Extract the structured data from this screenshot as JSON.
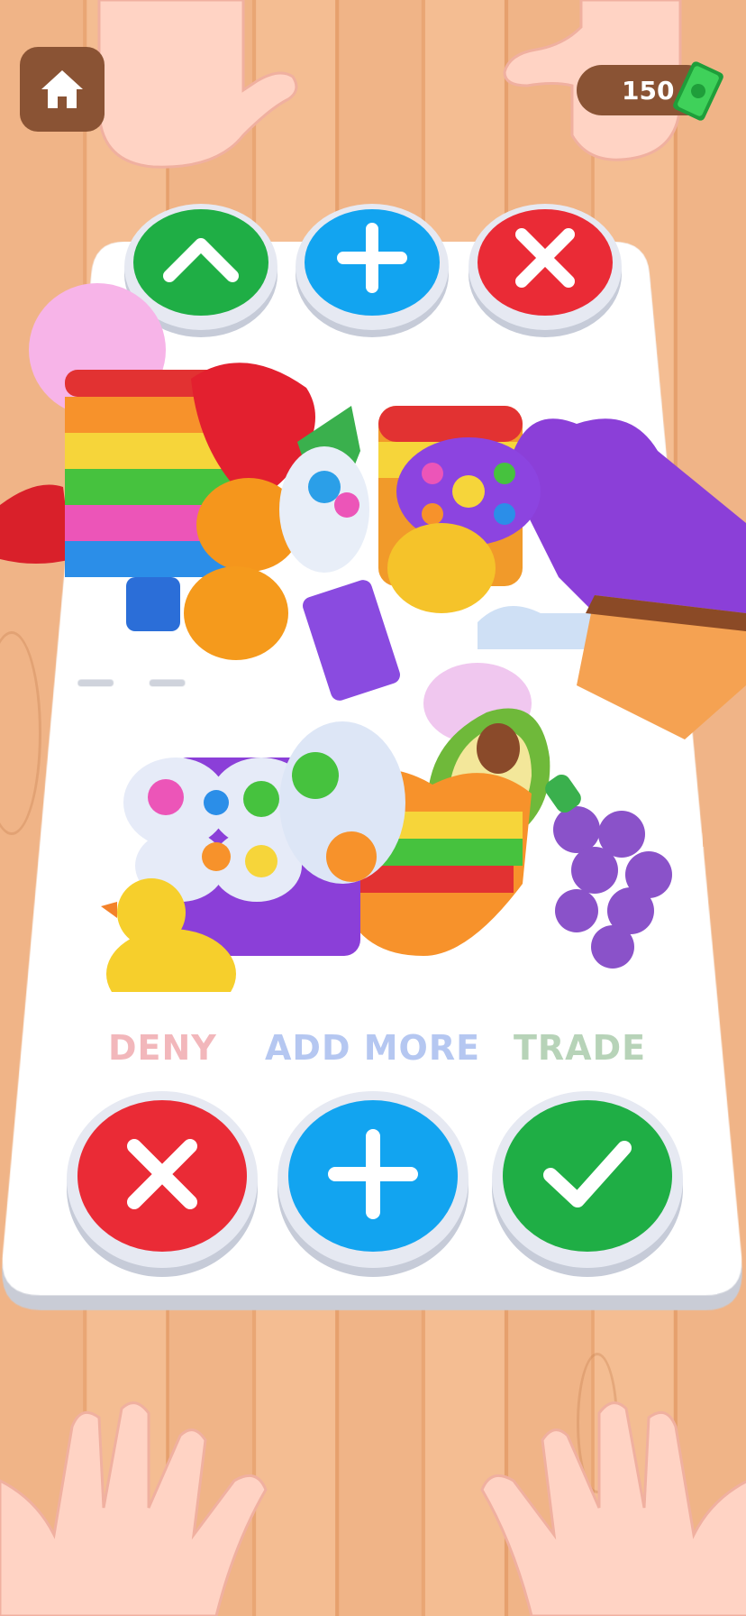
{
  "currency": {
    "amount": "150",
    "icon": "cash-icon"
  },
  "home": {
    "icon": "home-icon"
  },
  "opponent_buttons": [
    {
      "name": "up-arrow-button",
      "icon": "chevron-up-icon",
      "color": "#1fae45"
    },
    {
      "name": "add-button",
      "icon": "plus-icon",
      "color": "#12a4f0"
    },
    {
      "name": "deny-button",
      "icon": "close-icon",
      "color": "#ea2b36"
    }
  ],
  "actions": {
    "deny_label": "DENY",
    "add_more_label": "ADD MORE",
    "trade_label": "TRADE"
  },
  "colors": {
    "deny": "#ea2b36",
    "add_more": "#12a4f0",
    "trade": "#1fae45",
    "wood": "#f0b487",
    "tray": "#ffffff"
  }
}
